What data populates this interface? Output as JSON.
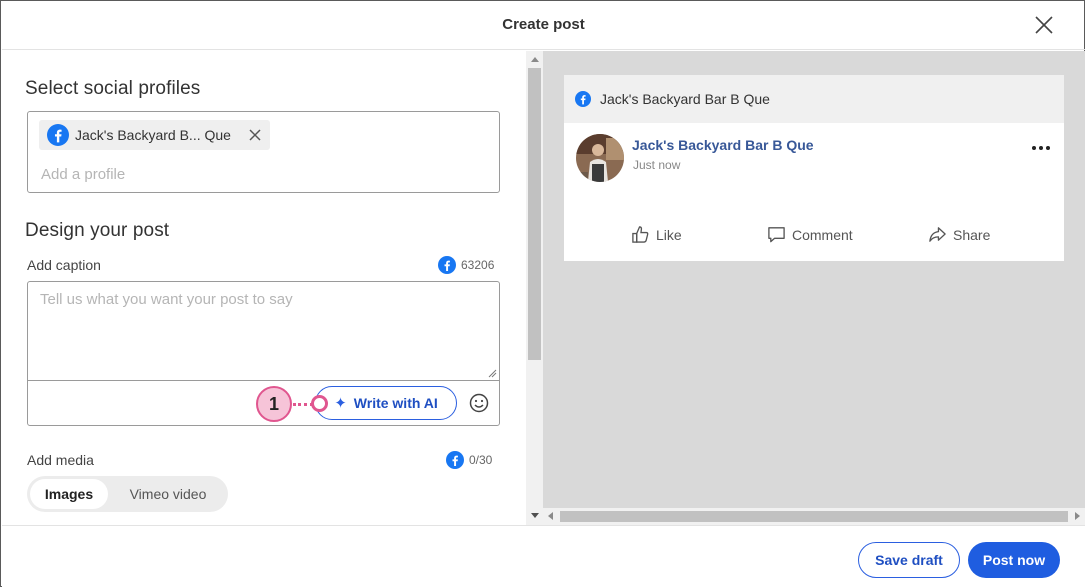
{
  "header": {
    "title": "Create post"
  },
  "profiles": {
    "section_title": "Select social profiles",
    "selected": [
      {
        "name": "Jack's Backyard B... Que",
        "network": "facebook"
      }
    ],
    "add_placeholder": "Add a profile"
  },
  "design": {
    "section_title": "Design your post",
    "caption_label": "Add caption",
    "caption_counter": "63206",
    "caption_placeholder": "Tell us what you want your post to say",
    "ai_button_label": "Write with AI",
    "callout_number": "1"
  },
  "media": {
    "label": "Add media",
    "counter": "0/30",
    "tabs": [
      {
        "label": "Images",
        "active": true
      },
      {
        "label": "Vimeo video",
        "active": false
      }
    ]
  },
  "preview": {
    "profile_label": "Jack's Backyard Bar B Que",
    "author": "Jack's Backyard Bar B Que",
    "timestamp": "Just now",
    "actions": {
      "like": "Like",
      "comment": "Comment",
      "share": "Share"
    }
  },
  "footer": {
    "save_draft_label": "Save draft",
    "post_now_label": "Post now"
  },
  "colors": {
    "accent": "#1f5de0",
    "facebook": "#1877f2",
    "callout": "#e0568f",
    "preview_bg": "#d9d9d9"
  },
  "icons": [
    "close-icon",
    "facebook-icon",
    "remove-x-icon",
    "sparkle-icon",
    "emoji-icon",
    "like-icon",
    "comment-icon",
    "share-icon",
    "more-icon"
  ]
}
